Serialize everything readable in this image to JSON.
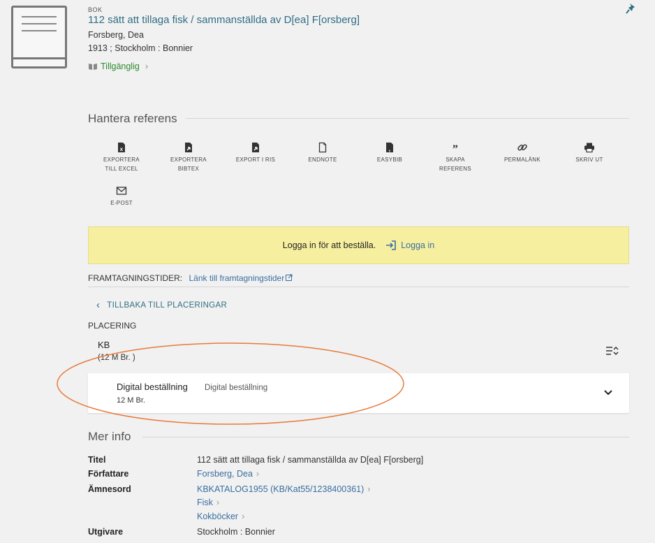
{
  "record": {
    "type": "BOK",
    "title": "112 sätt att tillaga fisk / sammanställda av D[ea] F[orsberg]",
    "author": "Forsberg, Dea",
    "date_place": "1913 ; Stockholm : Bonnier",
    "availability": "Tillgänglig"
  },
  "manage": {
    "title": "Hantera referens",
    "actions": [
      {
        "line1": "EXPORTERA",
        "line2": "TILL EXCEL"
      },
      {
        "line1": "EXPORTERA",
        "line2": "BIBTEX"
      },
      {
        "line1": "EXPORT I RIS",
        "line2": ""
      },
      {
        "line1": "ENDNOTE",
        "line2": ""
      },
      {
        "line1": "EASYBIB",
        "line2": ""
      },
      {
        "line1": "SKAPA",
        "line2": "REFERENS"
      },
      {
        "line1": "PERMALÄNK",
        "line2": ""
      },
      {
        "line1": "SKRIV UT",
        "line2": ""
      },
      {
        "line1": "E-POST",
        "line2": ""
      }
    ]
  },
  "login": {
    "message": "Logga in för att beställa.",
    "link": "Logga in"
  },
  "framtagning": {
    "label": "FRAMTAGNINGSTIDER:",
    "link": "Länk till framtagningstider"
  },
  "location": {
    "back": "TILLBAKA TILL PLACERINGAR",
    "heading": "PLACERING",
    "library": "KB",
    "shelf": "(12 M Br. )",
    "item_title": "Digital beställning",
    "item_sub": "Digital beställning",
    "item_count": "12 M Br."
  },
  "more": {
    "title": "Mer info",
    "rows": [
      {
        "label": "Titel",
        "values": [
          "112 sätt att tillaga fisk / sammanställda av D[ea] F[orsberg]"
        ],
        "link": false
      },
      {
        "label": "Författare",
        "values": [
          "Forsberg, Dea"
        ],
        "link": true
      },
      {
        "label": "Ämnesord",
        "values": [
          "KBKATALOG1955 (KB/Kat55/1238400361)",
          "Fisk",
          "Kokböcker"
        ],
        "link": true
      },
      {
        "label": "Utgivare",
        "values": [
          "Stockholm : Bonnier"
        ],
        "link": false
      }
    ]
  },
  "colors": {
    "accent": "#2f6e84",
    "link": "#3a6ea0",
    "available": "#2e8a2e",
    "login_bg": "#f7efa0",
    "annotation": "#e8793a"
  }
}
